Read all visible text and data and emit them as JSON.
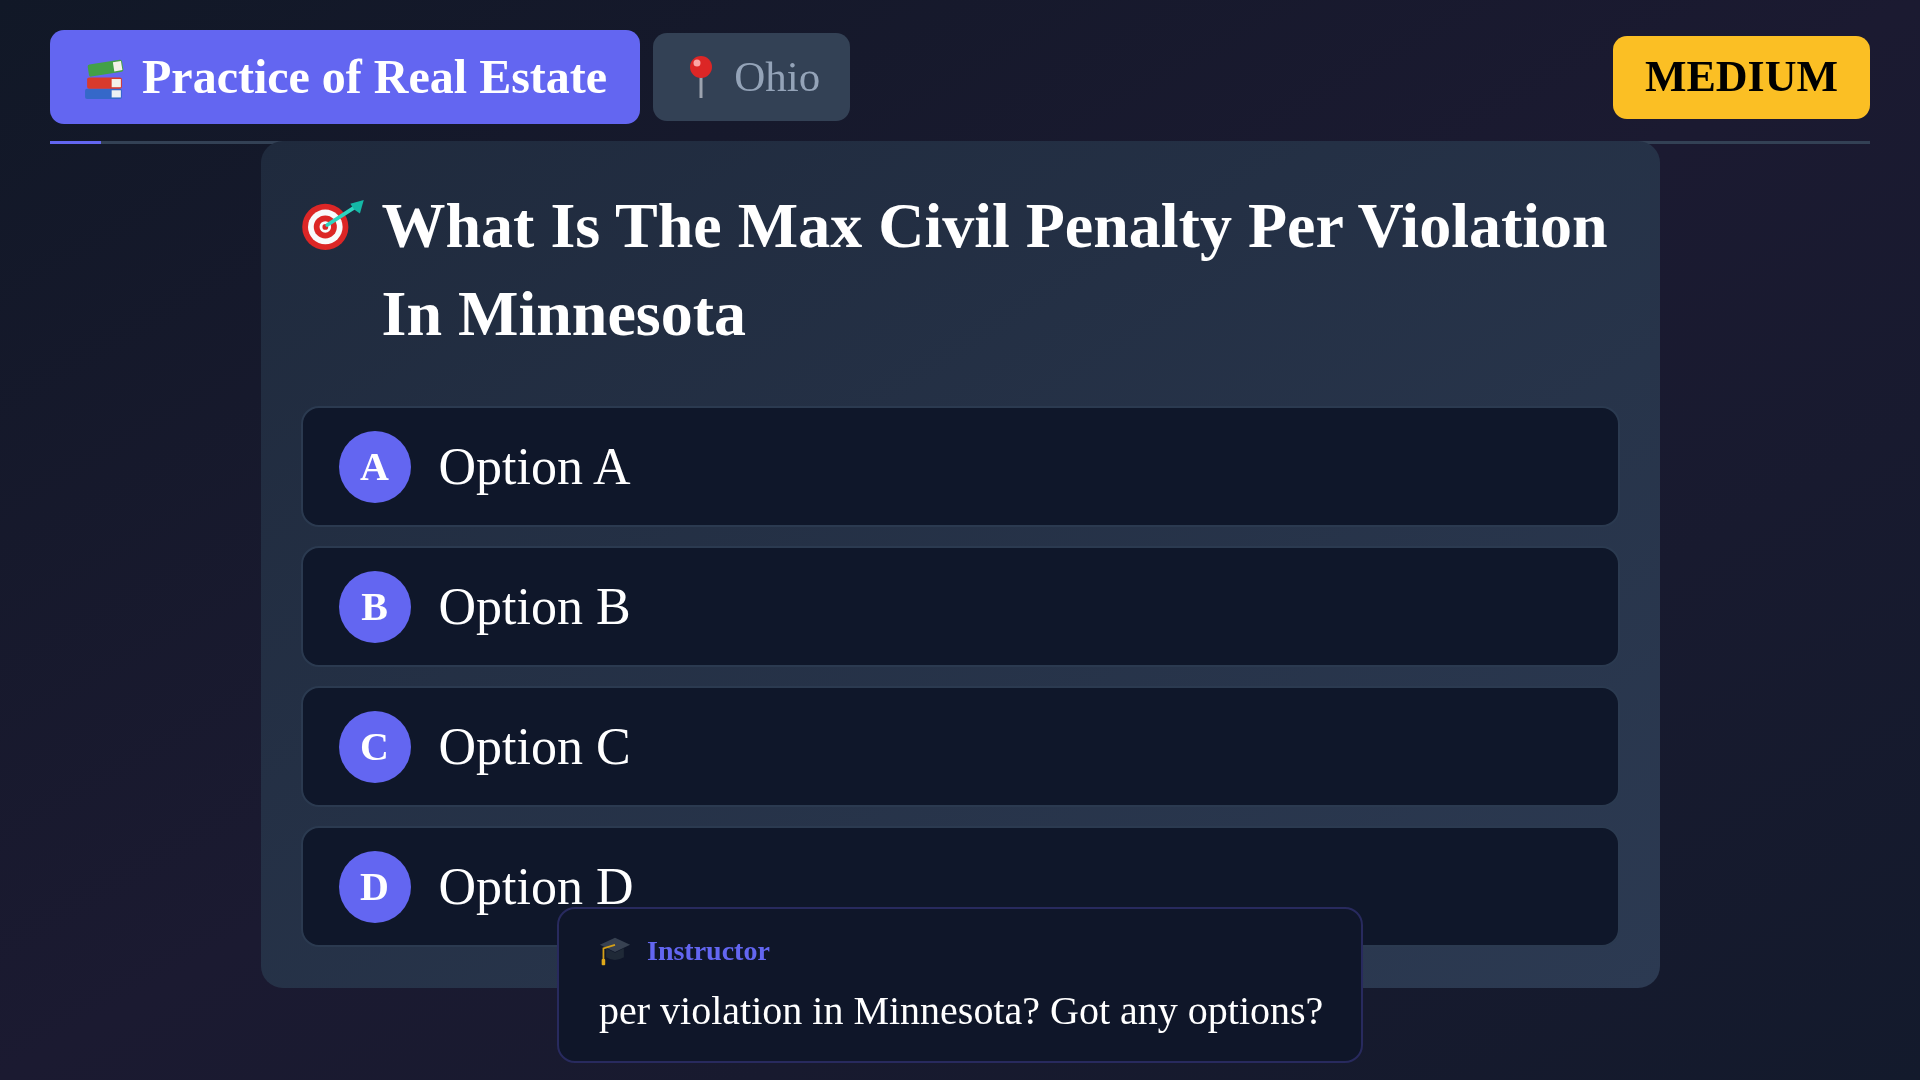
{
  "header": {
    "badges": [
      {
        "kind": "subject",
        "label": "Practice of Real Estate"
      },
      {
        "kind": "state",
        "label": "Ohio"
      }
    ],
    "difficulty": "MEDIUM"
  },
  "progress": {
    "level": 0.028
  },
  "question": {
    "title": "What Is The Max Civil Penalty Per Violation In Minnesota",
    "options": [
      {
        "letter": "A",
        "text": "Option A"
      },
      {
        "letter": "B",
        "text": "Option B"
      },
      {
        "letter": "C",
        "text": "Option C"
      },
      {
        "letter": "D",
        "text": "Option D"
      }
    ]
  },
  "caption": {
    "speaker": "Instructor",
    "text": "per violation in Minnesota? Got any options?"
  }
}
